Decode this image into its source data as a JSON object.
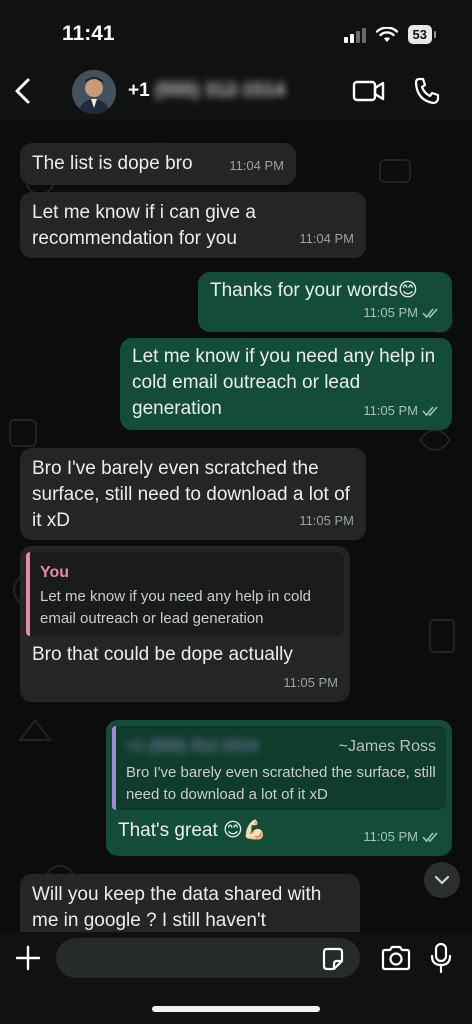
{
  "status_bar": {
    "time": "11:41",
    "battery": "53"
  },
  "header": {
    "contact_prefix": "+1",
    "contact_number_blurred": "(555) 312-1514"
  },
  "messages": [
    {
      "text": "The list is dope bro",
      "time": "11:04 PM"
    },
    {
      "text": "Let me know if i can give a recommendation for you",
      "time": "11:04 PM"
    },
    {
      "text": "Thanks for your words😊",
      "time": "11:05 PM"
    },
    {
      "text": "Let me know if you need any help in cold email outreach or lead generation",
      "time": "11:05 PM"
    },
    {
      "text": "Bro I've barely even scratched the surface, still need to download a lot of it xD",
      "time": "11:05 PM"
    },
    {
      "quote_author": "You",
      "quote_text": "Let me know if you need any help in cold email outreach or lead generation",
      "text": "Bro that could be dope actually",
      "time": "11:05 PM"
    },
    {
      "quote_author_blurred": "+1 (555) 312-1514",
      "quote_name": "~James  Ross",
      "quote_text": "Bro I've barely even scratched the surface, still need to download a lot of it xD",
      "text": "That's great 😊💪🏻",
      "time": "11:05 PM"
    },
    {
      "text": "Will you keep the data shared with me in google ? I still haven't"
    }
  ],
  "input": {
    "placeholder": ""
  },
  "colors": {
    "incoming": "#242626",
    "outgoing": "#144d37",
    "quote_you": "#e58da1",
    "quote_other": "#9c8cd6"
  },
  "icons": [
    "back-chevron-icon",
    "video-call-icon",
    "phone-icon",
    "double-check-icon",
    "chevron-down-icon",
    "plus-icon",
    "sticker-icon",
    "camera-icon",
    "microphone-icon"
  ]
}
